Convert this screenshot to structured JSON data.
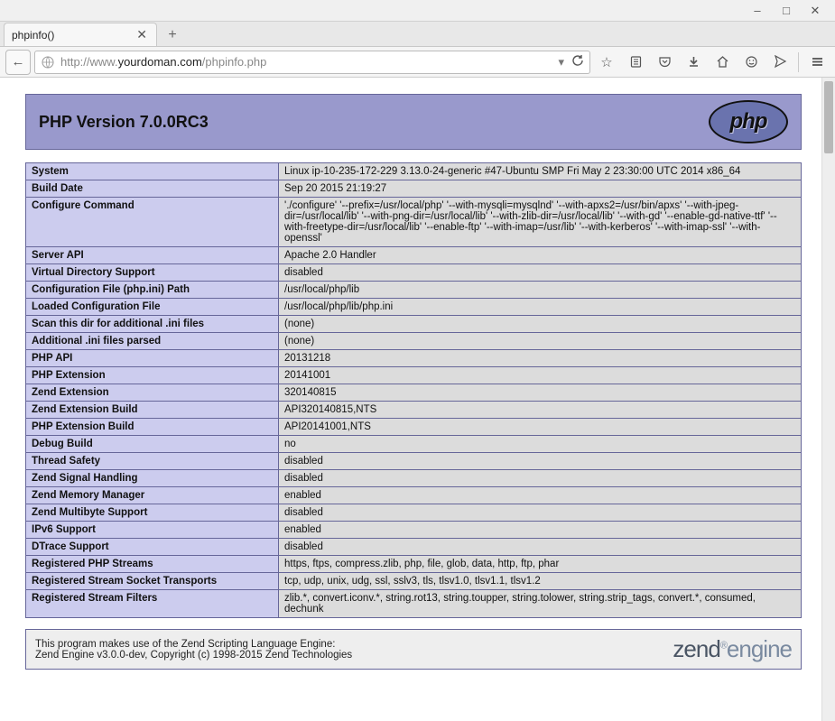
{
  "window": {
    "tab_title": "phpinfo()",
    "url_prefix": "http://www.",
    "url_domain": "yourdoman.com",
    "url_path": "/phpinfo.php"
  },
  "header": {
    "title": "PHP Version 7.0.0RC3",
    "logo_text": "php"
  },
  "rows": [
    {
      "label": "System",
      "value": "Linux ip-10-235-172-229 3.13.0-24-generic #47-Ubuntu SMP Fri May 2 23:30:00 UTC 2014 x86_64"
    },
    {
      "label": "Build Date",
      "value": "Sep 20 2015 21:19:27"
    },
    {
      "label": "Configure Command",
      "value": "'./configure' '--prefix=/usr/local/php' '--with-mysqli=mysqlnd' '--with-apxs2=/usr/bin/apxs' '--with-jpeg-dir=/usr/local/lib' '--with-png-dir=/usr/local/lib' '--with-zlib-dir=/usr/local/lib' '--with-gd' '--enable-gd-native-ttf' '--with-freetype-dir=/usr/local/lib' '--enable-ftp' '--with-imap=/usr/lib' '--with-kerberos' '--with-imap-ssl' '--with-openssl'"
    },
    {
      "label": "Server API",
      "value": "Apache 2.0 Handler"
    },
    {
      "label": "Virtual Directory Support",
      "value": "disabled"
    },
    {
      "label": "Configuration File (php.ini) Path",
      "value": "/usr/local/php/lib"
    },
    {
      "label": "Loaded Configuration File",
      "value": "/usr/local/php/lib/php.ini"
    },
    {
      "label": "Scan this dir for additional .ini files",
      "value": "(none)"
    },
    {
      "label": "Additional .ini files parsed",
      "value": "(none)"
    },
    {
      "label": "PHP API",
      "value": "20131218"
    },
    {
      "label": "PHP Extension",
      "value": "20141001"
    },
    {
      "label": "Zend Extension",
      "value": "320140815"
    },
    {
      "label": "Zend Extension Build",
      "value": "API320140815,NTS"
    },
    {
      "label": "PHP Extension Build",
      "value": "API20141001,NTS"
    },
    {
      "label": "Debug Build",
      "value": "no"
    },
    {
      "label": "Thread Safety",
      "value": "disabled"
    },
    {
      "label": "Zend Signal Handling",
      "value": "disabled"
    },
    {
      "label": "Zend Memory Manager",
      "value": "enabled"
    },
    {
      "label": "Zend Multibyte Support",
      "value": "disabled"
    },
    {
      "label": "IPv6 Support",
      "value": "enabled"
    },
    {
      "label": "DTrace Support",
      "value": "disabled"
    },
    {
      "label": "Registered PHP Streams",
      "value": "https, ftps, compress.zlib, php, file, glob, data, http, ftp, phar"
    },
    {
      "label": "Registered Stream Socket Transports",
      "value": "tcp, udp, unix, udg, ssl, sslv3, tls, tlsv1.0, tlsv1.1, tlsv1.2"
    },
    {
      "label": "Registered Stream Filters",
      "value": "zlib.*, convert.iconv.*, string.rot13, string.toupper, string.tolower, string.strip_tags, convert.*, consumed, dechunk"
    }
  ],
  "zend": {
    "line1": "This program makes use of the Zend Scripting Language Engine:",
    "line2": "Zend Engine v3.0.0-dev, Copyright (c) 1998-2015 Zend Technologies",
    "logo_left": "zend",
    "logo_right": "engine"
  }
}
